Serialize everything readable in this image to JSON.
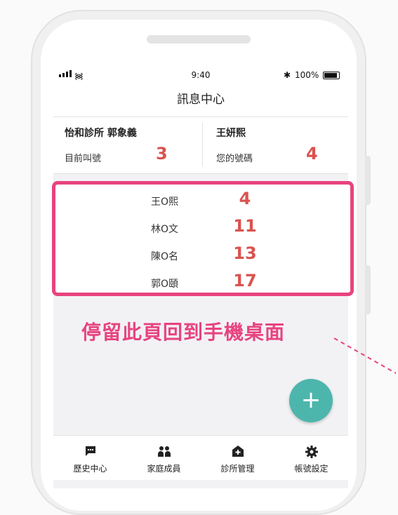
{
  "status_bar": {
    "time": "9:40",
    "battery": "100%"
  },
  "header": {
    "title": "訊息中心"
  },
  "info": {
    "clinic": "怡和診所 郭象義",
    "patient": "王妍熙",
    "current_label": "目前叫號",
    "current_number": "3",
    "my_label": "您的號碼",
    "my_number": "4"
  },
  "queue": [
    {
      "name": "王O熙",
      "number": "4"
    },
    {
      "name": "林O文",
      "number": "11"
    },
    {
      "name": "陳O名",
      "number": "13"
    },
    {
      "name": "郭O頤",
      "number": "17"
    }
  ],
  "caption": "停留此頁回到手機桌面",
  "fab": {
    "icon": "plus-icon",
    "label": "+"
  },
  "tabs": [
    {
      "label": "歷史中心",
      "icon": "chat-icon"
    },
    {
      "label": "家庭成員",
      "icon": "people-icon"
    },
    {
      "label": "診所管理",
      "icon": "clinic-icon"
    },
    {
      "label": "帳號設定",
      "icon": "gear-icon"
    }
  ],
  "colors": {
    "accent": "#e8437f",
    "number": "#d9534f",
    "fab": "#4db6ac"
  }
}
